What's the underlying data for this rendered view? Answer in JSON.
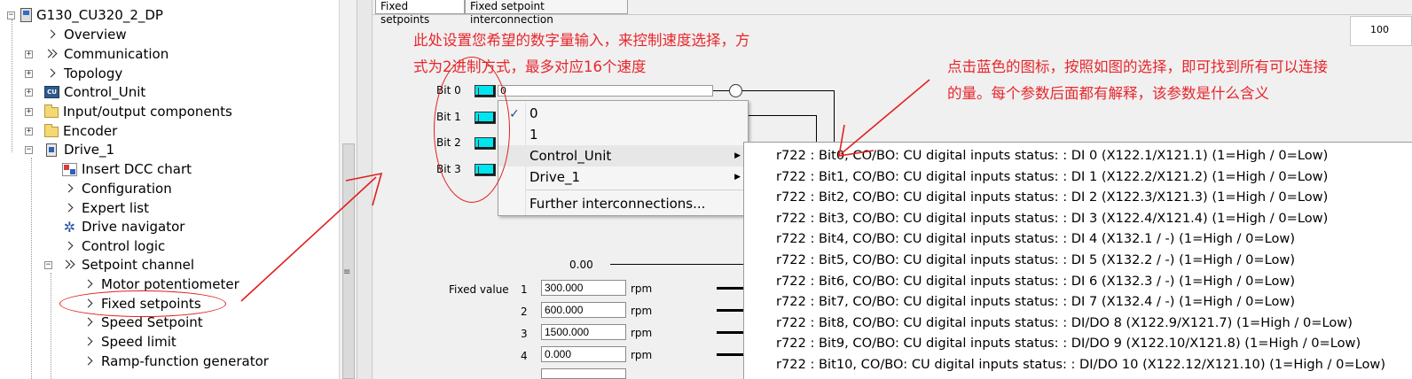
{
  "tree": {
    "root": "G130_CU320_2_DP",
    "items": [
      {
        "label": "Overview",
        "icon": "chevron-icon"
      },
      {
        "label": "Communication",
        "icon": "double-chevron-icon"
      },
      {
        "label": "Topology",
        "icon": "chevron-icon"
      },
      {
        "label": "Control_Unit",
        "icon": "control-unit-icon"
      },
      {
        "label": "Input/output components",
        "icon": "folder-icon"
      },
      {
        "label": "Encoder",
        "icon": "folder-icon"
      },
      {
        "label": "Drive_1",
        "icon": "drive-icon"
      },
      {
        "label": "Insert DCC chart",
        "icon": "dcc-chart-icon"
      },
      {
        "label": "Configuration",
        "icon": "chevron-icon"
      },
      {
        "label": "Expert list",
        "icon": "chevron-icon"
      },
      {
        "label": "Drive navigator",
        "icon": "navigator-icon"
      },
      {
        "label": "Control logic",
        "icon": "chevron-icon"
      },
      {
        "label": "Setpoint channel",
        "icon": "double-chevron-icon"
      },
      {
        "label": "Motor potentiometer",
        "icon": "chevron-icon"
      },
      {
        "label": "Fixed setpoints",
        "icon": "chevron-icon"
      },
      {
        "label": "Speed Setpoint",
        "icon": "chevron-icon"
      },
      {
        "label": "Speed limit",
        "icon": "chevron-icon"
      },
      {
        "label": "Ramp-function generator",
        "icon": "chevron-icon"
      }
    ]
  },
  "tabs": [
    "Fixed setpoints",
    "Fixed setpoint interconnection"
  ],
  "zoom_text": "100",
  "bits": [
    "Bit 0",
    "Bit 1",
    "Bit 2",
    "Bit 3"
  ],
  "bit0_value": "0",
  "context_menu": {
    "items": [
      "0",
      "1",
      "Control_Unit",
      "Drive_1",
      "Further interconnections..."
    ],
    "checked": "0",
    "highlighted": "Control_Unit"
  },
  "submenu": [
    "r722 :  Bit0, CO/BO: CU digital inputs status: : DI 0 (X122.1/X121.1) (1=High / 0=Low)",
    "r722 :  Bit1, CO/BO: CU digital inputs status: : DI 1 (X122.2/X121.2) (1=High / 0=Low)",
    "r722 :  Bit2, CO/BO: CU digital inputs status: : DI 2 (X122.3/X121.3) (1=High / 0=Low)",
    "r722 :  Bit3, CO/BO: CU digital inputs status: : DI 3 (X122.4/X121.4) (1=High / 0=Low)",
    "r722 :  Bit4, CO/BO: CU digital inputs status: : DI 4 (X132.1 / -) (1=High / 0=Low)",
    "r722 :  Bit5, CO/BO: CU digital inputs status: : DI 5 (X132.2 / -) (1=High / 0=Low)",
    "r722 :  Bit6, CO/BO: CU digital inputs status: : DI 6 (X132.3 / -) (1=High / 0=Low)",
    "r722 :  Bit7, CO/BO: CU digital inputs status: : DI 7 (X132.4 / -) (1=High / 0=Low)",
    "r722 :  Bit8, CO/BO: CU digital inputs status: : DI/DO 8 (X122.9/X121.7) (1=High / 0=Low)",
    "r722 :  Bit9, CO/BO: CU digital inputs status: : DI/DO 9 (X122.10/X121.8) (1=High / 0=Low)",
    "r722 :  Bit10, CO/BO: CU digital inputs status: : DI/DO 10 (X122.12/X121.10) (1=High / 0=Low)"
  ],
  "result_value": "0.00",
  "fixed_values": {
    "label": "Fixed value",
    "rows": [
      {
        "index": "1",
        "value": "300.000",
        "unit": "rpm"
      },
      {
        "index": "2",
        "value": "600.000",
        "unit": "rpm"
      },
      {
        "index": "3",
        "value": "1500.000",
        "unit": "rpm"
      },
      {
        "index": "4",
        "value": "0.000",
        "unit": "rpm"
      }
    ]
  },
  "annotations": {
    "left_line1": "此处设置您希望的数字量输入，来控制速度选择，方",
    "left_line2": "式为2进制方式，最多对应16个速度",
    "right_line1": "点击蓝色的图标，按照如图的选择，即可找到所有可以连接",
    "right_line2": "的量。每个参数后面都有解释，该参数是什么含义"
  },
  "colors": {
    "annotation": "#e8262c",
    "connector": "#00e5ee",
    "panel_bg": "#f0f0f0"
  }
}
